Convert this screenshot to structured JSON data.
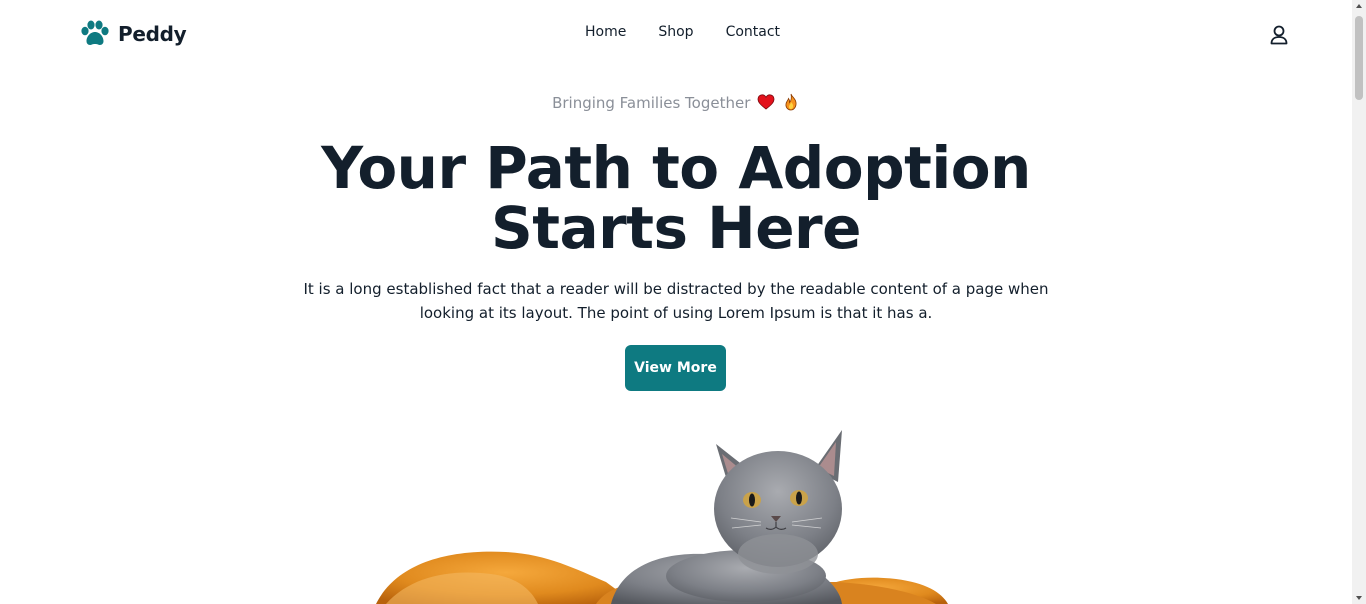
{
  "brand": {
    "name": "Peddy",
    "logo_icon": "paw-icon",
    "accent": "#0e7a81"
  },
  "nav": {
    "items": [
      {
        "label": "Home"
      },
      {
        "label": "Shop"
      },
      {
        "label": "Contact"
      }
    ]
  },
  "header": {
    "user_icon": "user-icon"
  },
  "hero": {
    "eyebrow": "Bringing Families Together",
    "eyebrow_icons": [
      "heart-icon",
      "fire-icon"
    ],
    "title_line1": "Your Path to Adoption",
    "title_line2": "Starts Here",
    "description": "It is a long established fact that a reader will be distracted by the readable content of a page when looking at its layout. The point of using Lorem Ipsum is that it has a.",
    "cta_label": "View More",
    "image_alt": "Grey kitten lying on an orange dog"
  },
  "colors": {
    "text": "#131f2c",
    "muted": "#8a8f98",
    "button": "#0e7a81",
    "button_text": "#ffffff"
  }
}
